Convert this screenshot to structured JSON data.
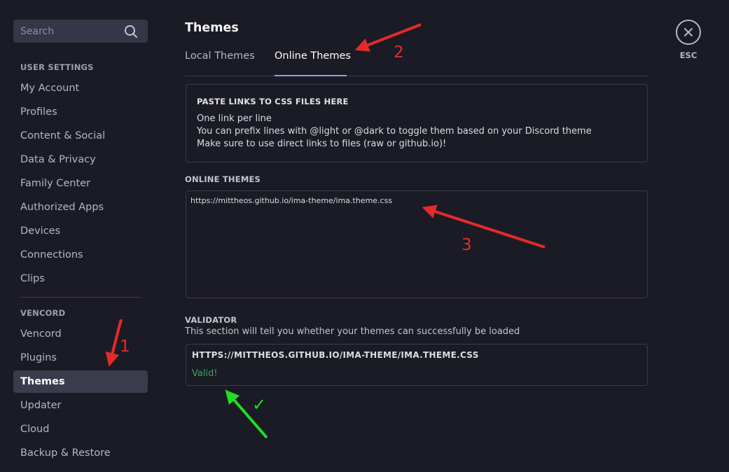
{
  "sidebar": {
    "search_placeholder": "Search",
    "sections": [
      {
        "header": "USER SETTINGS",
        "items": [
          {
            "label": "My Account"
          },
          {
            "label": "Profiles"
          },
          {
            "label": "Content & Social"
          },
          {
            "label": "Data & Privacy"
          },
          {
            "label": "Family Center"
          },
          {
            "label": "Authorized Apps"
          },
          {
            "label": "Devices"
          },
          {
            "label": "Connections"
          },
          {
            "label": "Clips"
          }
        ]
      },
      {
        "header": "VENCORD",
        "items": [
          {
            "label": "Vencord"
          },
          {
            "label": "Plugins"
          },
          {
            "label": "Themes",
            "active": true
          },
          {
            "label": "Updater"
          },
          {
            "label": "Cloud"
          },
          {
            "label": "Backup & Restore"
          }
        ]
      }
    ]
  },
  "page": {
    "title": "Themes",
    "tabs": [
      {
        "label": "Local Themes"
      },
      {
        "label": "Online Themes",
        "active": true
      }
    ]
  },
  "info_card": {
    "title": "PASTE LINKS TO CSS FILES HERE",
    "lines": [
      "One link per line",
      "You can prefix lines with @light or @dark to toggle them based on your Discord theme",
      "Make sure to use direct links to files (raw or github.io)!"
    ]
  },
  "online_themes": {
    "label": "ONLINE THEMES",
    "value": "https://mittheos.github.io/ima-theme/ima.theme.css"
  },
  "validator": {
    "label": "VALIDATOR",
    "description": "This section will tell you whether your themes can successfully be loaded",
    "result_url": "HTTPS://MITTHEOS.GITHUB.IO/IMA-THEME/IMA.THEME.CSS",
    "result_status": "Valid!"
  },
  "close": {
    "label": "ESC",
    "icon": "close-icon"
  },
  "annotations": {
    "numbers": [
      "1",
      "2",
      "3"
    ],
    "check": "✓",
    "colors": {
      "red": "#e32a2a",
      "green": "#22dd22"
    }
  },
  "colors": {
    "background": "#1b1b25",
    "active_item": "#3a3c4b",
    "tab_accent": "#949cf7",
    "valid": "#3ba55c"
  }
}
